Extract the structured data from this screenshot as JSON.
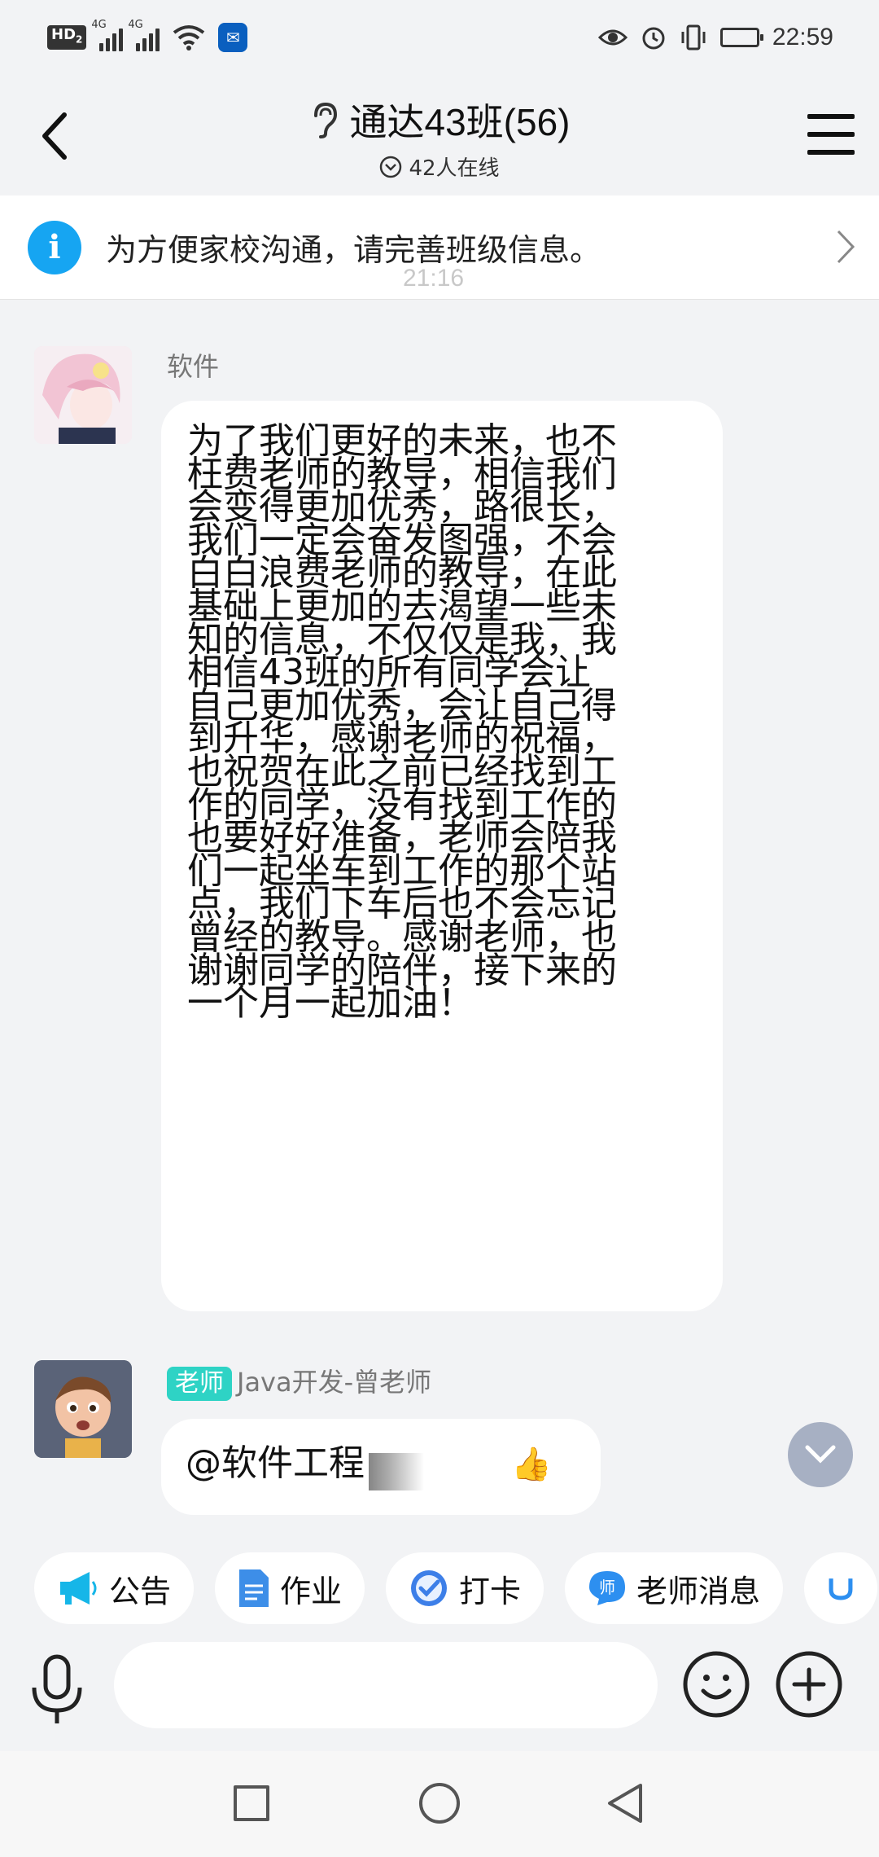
{
  "status_bar": {
    "hd_label": "HD",
    "hd_sub": "2",
    "net1": "4G",
    "net2": "4G",
    "time": "22:59"
  },
  "header": {
    "title": "通达43班(56)",
    "online": "42人在线"
  },
  "notice": {
    "text": "为方便家校沟通，请完善班级信息。"
  },
  "ghost_timestamp": "21:16",
  "messages": [
    {
      "sender": "软件",
      "lines": [
        "为了我们更好的未来，也不",
        "枉费老师的教导，相信我们",
        "会变得更加优秀，路很长，",
        "我们一定会奋发图强，不会",
        "白白浪费老师的教导，在此",
        "基础上更加的去渴望一些未",
        "知的信息，不仅仅是我，我",
        "相信43班的所有同学会让",
        "自己更加优秀，会让自己得",
        "到升华，感谢老师的祝福，",
        "也祝贺在此之前已经找到工",
        "作的同学，没有找到工作的",
        "也要好好准备，老师会陪我",
        "们一起坐车到工作的那个站",
        "点，我们下车后也不会忘记",
        "曾经的教导。感谢老师，也",
        "谢谢同学的陪伴，接下来的",
        "一个月一起加油！"
      ]
    },
    {
      "badge": "老师",
      "sender": "Java开发-曾老师",
      "text": "@软件工程",
      "trailing_emoji": "👍"
    }
  ],
  "quick_actions": [
    {
      "label": "公告",
      "icon": "megaphone-icon",
      "color": "#16b6e8"
    },
    {
      "label": "作业",
      "icon": "document-icon",
      "color": "#3d8ee8"
    },
    {
      "label": "打卡",
      "icon": "checkin-icon",
      "color": "#3d7fe8"
    },
    {
      "label": "老师消息",
      "icon": "teacher-message-icon",
      "color": "#2d8ff0"
    }
  ],
  "colors": {
    "accent_blue": "#16a5f2",
    "teacher_badge": "#2ed3c5",
    "background": "#f2f3f5"
  }
}
